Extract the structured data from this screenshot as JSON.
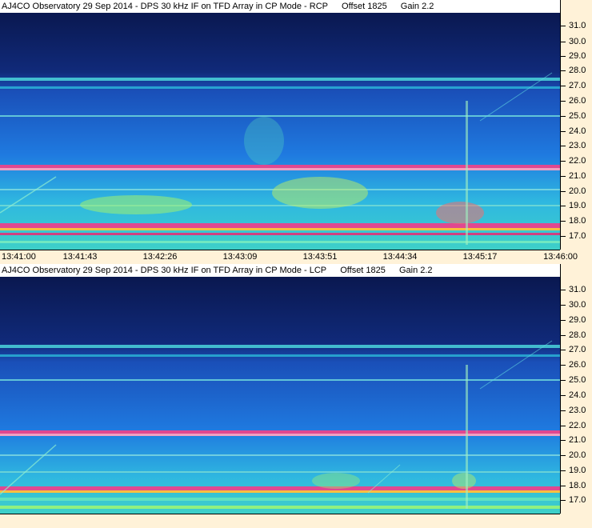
{
  "top_panel": {
    "title": "AJ4CO Observatory 29 Sep 2014 - DPS 30 kHz IF on TFD Array in CP Mode - RCP",
    "offset": "Offset 1825",
    "gain": "Gain 2.2"
  },
  "bottom_panel": {
    "title": "AJ4CO Observatory 29 Sep 2014 - DPS 30 kHz IF on TFD Array in CP Mode - LCP",
    "offset": "Offset 1825",
    "gain": "Gain 2.2"
  },
  "freq_axis": [
    "31.0",
    "30.0",
    "29.0",
    "28.0",
    "27.0",
    "26.0",
    "25.0",
    "24.0",
    "23.0",
    "22.0",
    "21.0",
    "20.0",
    "19.0",
    "18.0",
    "17.0"
  ],
  "time_axis": [
    "13:41:00",
    "13:41:43",
    "13:42:26",
    "13:43:09",
    "13:43:51",
    "13:44:34",
    "13:45:17",
    "13:46:00"
  ],
  "colors": {
    "background": "#fff2d8",
    "spectrum_low": "#0b1a5c",
    "spectrum_mid": "#1b6fd8",
    "spectrum_high": "#49e0d8",
    "spectrum_hot": "#e04890"
  }
}
